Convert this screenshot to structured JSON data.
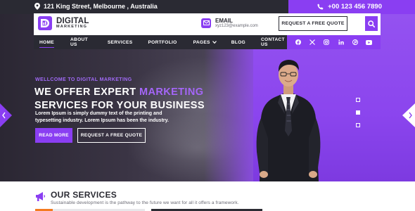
{
  "topbar": {
    "address": "121 King Street, Melbourne , Australia",
    "phone": "+00 123 456 7890"
  },
  "header": {
    "logo_line1": "DIGITAL",
    "logo_line2": "MARKETING",
    "email_label": "EMAIL",
    "email_value": "xyz123@example.com",
    "quote_button": "REQUEST A FREE QUOTE"
  },
  "nav": {
    "items": [
      {
        "label": "HOME"
      },
      {
        "label": "ABOUT US"
      },
      {
        "label": "SERVICES"
      },
      {
        "label": "PORTFOLIO"
      },
      {
        "label": "PAGES"
      },
      {
        "label": "BLOG"
      },
      {
        "label": "CONTACT US"
      }
    ]
  },
  "social": [
    "facebook-icon",
    "x-icon",
    "instagram-icon",
    "linkedin-icon",
    "pinterest-icon",
    "youtube-icon"
  ],
  "hero": {
    "welcome": "WELLCOME TO DIGITAL MARKETING",
    "heading_pre": "WE OFFER EXPERT ",
    "heading_accent": "MARKETING",
    "heading_line2": "SERVICES FOR YOUR BUSINESS",
    "description": "Lorem Ipsum is simply dummy text of the printing and typesetting industry. Lorem  Ipsum has been the industry.",
    "read_more": "READ MORE",
    "quote_button": "REQUEST A FREE QUOTE"
  },
  "services": {
    "title": "OUR SERVICES",
    "subtitle": "Sustainable development is the pathway to the future we want for all it offers a framework."
  },
  "colors": {
    "accent": "#8a3ef2",
    "dark": "#2a2a33",
    "orange": "#f47a1f"
  }
}
